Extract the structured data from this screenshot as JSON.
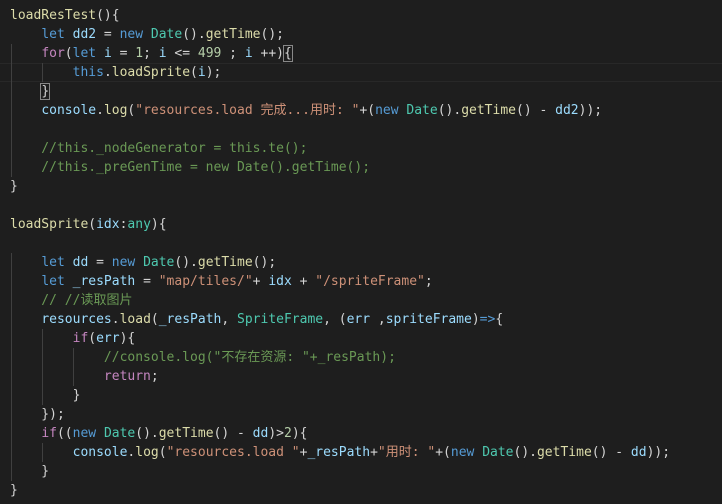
{
  "editor": {
    "theme_colors": {
      "background": "#1e1e1e",
      "keyword": "#569cd6",
      "control": "#c586c0",
      "function": "#dcdcaa",
      "variable": "#9cdcfe",
      "string": "#ce9178",
      "number": "#b5cea8",
      "class": "#4ec9b0",
      "comment": "#6a9955",
      "punctuation": "#d4d4d4"
    },
    "lines": [
      {
        "tokens": [
          {
            "t": "loadResTest",
            "c": "fn"
          },
          {
            "t": "(){",
            "c": "pun"
          }
        ]
      },
      {
        "tokens": [
          {
            "t": "    ",
            "c": "pun"
          },
          {
            "t": "let",
            "c": "kw"
          },
          {
            "t": " ",
            "c": "pun"
          },
          {
            "t": "dd2",
            "c": "var"
          },
          {
            "t": " = ",
            "c": "pun"
          },
          {
            "t": "new",
            "c": "kw"
          },
          {
            "t": " ",
            "c": "pun"
          },
          {
            "t": "Date",
            "c": "cls"
          },
          {
            "t": "().",
            "c": "pun"
          },
          {
            "t": "getTime",
            "c": "fn"
          },
          {
            "t": "();",
            "c": "pun"
          }
        ]
      },
      {
        "tokens": [
          {
            "t": "    ",
            "c": "pun"
          },
          {
            "t": "for",
            "c": "ctl"
          },
          {
            "t": "(",
            "c": "pun"
          },
          {
            "t": "let",
            "c": "kw"
          },
          {
            "t": " ",
            "c": "pun"
          },
          {
            "t": "i",
            "c": "var"
          },
          {
            "t": " = ",
            "c": "pun"
          },
          {
            "t": "1",
            "c": "num"
          },
          {
            "t": "; ",
            "c": "pun"
          },
          {
            "t": "i",
            "c": "var"
          },
          {
            "t": " <= ",
            "c": "pun"
          },
          {
            "t": "499",
            "c": "num"
          },
          {
            "t": " ; ",
            "c": "pun"
          },
          {
            "t": "i",
            "c": "var"
          },
          {
            "t": " ++)",
            "c": "pun"
          },
          {
            "t": "{",
            "c": "pun",
            "box": true
          }
        ]
      },
      {
        "tokens": [
          {
            "t": "        ",
            "c": "pun"
          },
          {
            "t": "this",
            "c": "kw"
          },
          {
            "t": ".",
            "c": "pun"
          },
          {
            "t": "loadSprite",
            "c": "fn"
          },
          {
            "t": "(",
            "c": "pun"
          },
          {
            "t": "i",
            "c": "var"
          },
          {
            "t": ");",
            "c": "pun"
          }
        ]
      },
      {
        "tokens": [
          {
            "t": "    ",
            "c": "pun"
          },
          {
            "t": "}",
            "c": "pun",
            "box": true
          }
        ]
      },
      {
        "tokens": [
          {
            "t": "    ",
            "c": "pun"
          },
          {
            "t": "console",
            "c": "var"
          },
          {
            "t": ".",
            "c": "pun"
          },
          {
            "t": "log",
            "c": "fn"
          },
          {
            "t": "(",
            "c": "pun"
          },
          {
            "t": "\"resources.load 完成...用时: \"",
            "c": "str"
          },
          {
            "t": "+(",
            "c": "pun"
          },
          {
            "t": "new",
            "c": "kw"
          },
          {
            "t": " ",
            "c": "pun"
          },
          {
            "t": "Date",
            "c": "cls"
          },
          {
            "t": "().",
            "c": "pun"
          },
          {
            "t": "getTime",
            "c": "fn"
          },
          {
            "t": "() - ",
            "c": "pun"
          },
          {
            "t": "dd2",
            "c": "var"
          },
          {
            "t": "));",
            "c": "pun"
          }
        ]
      },
      {
        "tokens": []
      },
      {
        "tokens": [
          {
            "t": "    //this._nodeGenerator = this.te();",
            "c": "cmt"
          }
        ]
      },
      {
        "tokens": [
          {
            "t": "    //this._preGenTime = new Date().getTime();",
            "c": "cmt"
          }
        ]
      },
      {
        "tokens": [
          {
            "t": "}",
            "c": "pun"
          }
        ]
      },
      {
        "tokens": []
      },
      {
        "tokens": [
          {
            "t": "loadSprite",
            "c": "fn"
          },
          {
            "t": "(",
            "c": "pun"
          },
          {
            "t": "idx",
            "c": "var"
          },
          {
            "t": ":",
            "c": "pun"
          },
          {
            "t": "any",
            "c": "cls"
          },
          {
            "t": "){",
            "c": "pun"
          }
        ]
      },
      {
        "tokens": []
      },
      {
        "tokens": [
          {
            "t": "    ",
            "c": "pun"
          },
          {
            "t": "let",
            "c": "kw"
          },
          {
            "t": " ",
            "c": "pun"
          },
          {
            "t": "dd",
            "c": "var"
          },
          {
            "t": " = ",
            "c": "pun"
          },
          {
            "t": "new",
            "c": "kw"
          },
          {
            "t": " ",
            "c": "pun"
          },
          {
            "t": "Date",
            "c": "cls"
          },
          {
            "t": "().",
            "c": "pun"
          },
          {
            "t": "getTime",
            "c": "fn"
          },
          {
            "t": "();",
            "c": "pun"
          }
        ]
      },
      {
        "tokens": [
          {
            "t": "    ",
            "c": "pun"
          },
          {
            "t": "let",
            "c": "kw"
          },
          {
            "t": " ",
            "c": "pun"
          },
          {
            "t": "_resPath",
            "c": "var"
          },
          {
            "t": " = ",
            "c": "pun"
          },
          {
            "t": "\"map/tiles/\"",
            "c": "str"
          },
          {
            "t": "+ ",
            "c": "pun"
          },
          {
            "t": "idx",
            "c": "var"
          },
          {
            "t": " + ",
            "c": "pun"
          },
          {
            "t": "\"/spriteFrame\"",
            "c": "str"
          },
          {
            "t": ";",
            "c": "pun"
          }
        ]
      },
      {
        "tokens": [
          {
            "t": "    // //读取图片",
            "c": "cmt"
          }
        ]
      },
      {
        "tokens": [
          {
            "t": "    ",
            "c": "pun"
          },
          {
            "t": "resources",
            "c": "var"
          },
          {
            "t": ".",
            "c": "pun"
          },
          {
            "t": "load",
            "c": "fn"
          },
          {
            "t": "(",
            "c": "pun"
          },
          {
            "t": "_resPath",
            "c": "var"
          },
          {
            "t": ", ",
            "c": "pun"
          },
          {
            "t": "SpriteFrame",
            "c": "cls"
          },
          {
            "t": ", (",
            "c": "pun"
          },
          {
            "t": "err",
            "c": "var"
          },
          {
            "t": " ,",
            "c": "pun"
          },
          {
            "t": "spriteFrame",
            "c": "var"
          },
          {
            "t": ")",
            "c": "pun"
          },
          {
            "t": "=>",
            "c": "kw"
          },
          {
            "t": "{",
            "c": "pun"
          }
        ]
      },
      {
        "tokens": [
          {
            "t": "        ",
            "c": "pun"
          },
          {
            "t": "if",
            "c": "ctl"
          },
          {
            "t": "(",
            "c": "pun"
          },
          {
            "t": "err",
            "c": "var"
          },
          {
            "t": "){",
            "c": "pun"
          }
        ]
      },
      {
        "tokens": [
          {
            "t": "            //console.log(\"不存在资源: \"+_resPath);",
            "c": "cmt"
          }
        ]
      },
      {
        "tokens": [
          {
            "t": "            ",
            "c": "pun"
          },
          {
            "t": "return",
            "c": "ctl"
          },
          {
            "t": ";",
            "c": "pun"
          }
        ]
      },
      {
        "tokens": [
          {
            "t": "        }",
            "c": "pun"
          }
        ]
      },
      {
        "tokens": [
          {
            "t": "    });",
            "c": "pun"
          }
        ]
      },
      {
        "tokens": [
          {
            "t": "    ",
            "c": "pun"
          },
          {
            "t": "if",
            "c": "ctl"
          },
          {
            "t": "((",
            "c": "pun"
          },
          {
            "t": "new",
            "c": "kw"
          },
          {
            "t": " ",
            "c": "pun"
          },
          {
            "t": "Date",
            "c": "cls"
          },
          {
            "t": "().",
            "c": "pun"
          },
          {
            "t": "getTime",
            "c": "fn"
          },
          {
            "t": "() - ",
            "c": "pun"
          },
          {
            "t": "dd",
            "c": "var"
          },
          {
            "t": ")>",
            "c": "pun"
          },
          {
            "t": "2",
            "c": "num"
          },
          {
            "t": "){",
            "c": "pun"
          }
        ]
      },
      {
        "tokens": [
          {
            "t": "        ",
            "c": "pun"
          },
          {
            "t": "console",
            "c": "var"
          },
          {
            "t": ".",
            "c": "pun"
          },
          {
            "t": "log",
            "c": "fn"
          },
          {
            "t": "(",
            "c": "pun"
          },
          {
            "t": "\"resources.load \"",
            "c": "str"
          },
          {
            "t": "+",
            "c": "pun"
          },
          {
            "t": "_resPath",
            "c": "var"
          },
          {
            "t": "+",
            "c": "pun"
          },
          {
            "t": "\"用时: \"",
            "c": "str"
          },
          {
            "t": "+(",
            "c": "pun"
          },
          {
            "t": "new",
            "c": "kw"
          },
          {
            "t": " ",
            "c": "pun"
          },
          {
            "t": "Date",
            "c": "cls"
          },
          {
            "t": "().",
            "c": "pun"
          },
          {
            "t": "getTime",
            "c": "fn"
          },
          {
            "t": "() - ",
            "c": "pun"
          },
          {
            "t": "dd",
            "c": "var"
          },
          {
            "t": "));",
            "c": "pun"
          }
        ]
      },
      {
        "tokens": [
          {
            "t": "    }",
            "c": "pun"
          }
        ]
      },
      {
        "tokens": [
          {
            "t": "}",
            "c": "pun"
          }
        ]
      }
    ]
  }
}
